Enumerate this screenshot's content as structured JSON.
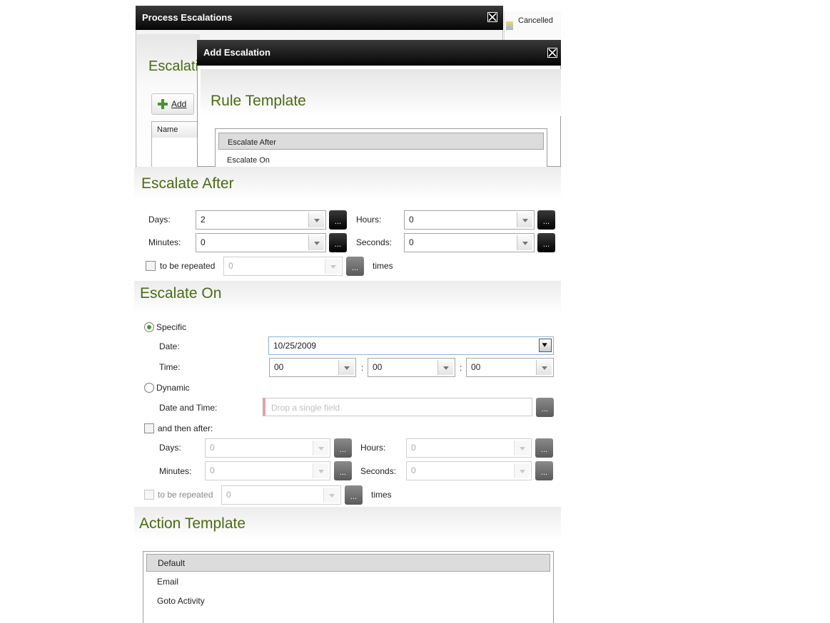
{
  "process_window": {
    "title": "Process Escalations",
    "heading": "Escalati",
    "add_button": "Add",
    "column_name": "Name",
    "behind_label": "Cancelled"
  },
  "add_window": {
    "title": "Add Escalation",
    "rule_template_heading": "Rule Template",
    "rule_templates": [
      "Escalate After",
      "Escalate On"
    ],
    "selected_rule": 0
  },
  "escalate_after": {
    "heading": "Escalate After",
    "days_label": "Days:",
    "days_value": "2",
    "hours_label": "Hours:",
    "hours_value": "0",
    "minutes_label": "Minutes:",
    "minutes_value": "0",
    "seconds_label": "Seconds:",
    "seconds_value": "0",
    "repeat_label": "to be repeated",
    "repeat_value": "0",
    "times_label": "times",
    "dots": "..."
  },
  "escalate_on": {
    "heading": "Escalate On",
    "specific_label": "Specific",
    "date_label": "Date:",
    "date_value": "10/25/2009",
    "time_label": "Time:",
    "time_hh": "00",
    "time_mm": "00",
    "time_ss": "00",
    "time_sep": ":",
    "dynamic_label": "Dynamic",
    "date_time_label": "Date and Time:",
    "drop_placeholder": "Drop a single field",
    "then_after_label": "and then after:",
    "days_label": "Days:",
    "days_value": "0",
    "hours_label": "Hours:",
    "hours_value": "0",
    "minutes_label": "Minutes:",
    "minutes_value": "0",
    "seconds_label": "Seconds:",
    "seconds_value": "0",
    "repeat_label": "to be repeated",
    "repeat_value": "0",
    "times_label": "times",
    "dots": "..."
  },
  "action_template": {
    "heading": "Action Template",
    "items": [
      "Default",
      "Email",
      "Goto Activity"
    ],
    "selected": 0
  },
  "colors": {
    "heading_green": "#4a6b12",
    "title_bar": "#000000",
    "radio_selected": "#3e9b2b"
  }
}
